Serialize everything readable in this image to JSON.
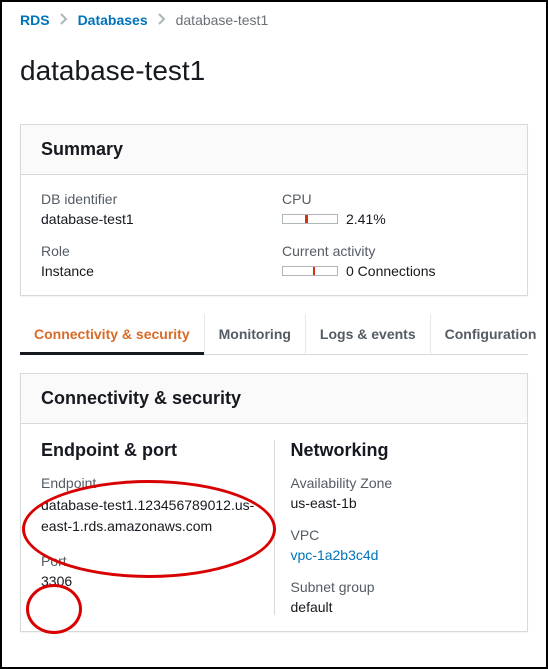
{
  "breadcrumb": {
    "items": [
      {
        "label": "RDS",
        "link": true
      },
      {
        "label": "Databases",
        "link": true
      },
      {
        "label": "database-test1",
        "link": false
      }
    ]
  },
  "title": "database-test1",
  "summary": {
    "heading": "Summary",
    "db_identifier_label": "DB identifier",
    "db_identifier_value": "database-test1",
    "role_label": "Role",
    "role_value": "Instance",
    "cpu_label": "CPU",
    "cpu_value": "2.41%",
    "activity_label": "Current activity",
    "activity_value": "0 Connections"
  },
  "tabs": [
    {
      "label": "Connectivity & security",
      "active": true
    },
    {
      "label": "Monitoring",
      "active": false
    },
    {
      "label": "Logs & events",
      "active": false
    },
    {
      "label": "Configuration",
      "active": false
    }
  ],
  "conn": {
    "heading": "Connectivity & security",
    "endpoint_port_heading": "Endpoint & port",
    "endpoint_label": "Endpoint",
    "endpoint_value": "database-test1.123456789012.us-east-1.rds.amazonaws.com",
    "port_label": "Port",
    "port_value": "3306",
    "networking_heading": "Networking",
    "az_label": "Availability Zone",
    "az_value": "us-east-1b",
    "vpc_label": "VPC",
    "vpc_value": "vpc-1a2b3c4d",
    "subnet_label": "Subnet group",
    "subnet_value": "default"
  }
}
